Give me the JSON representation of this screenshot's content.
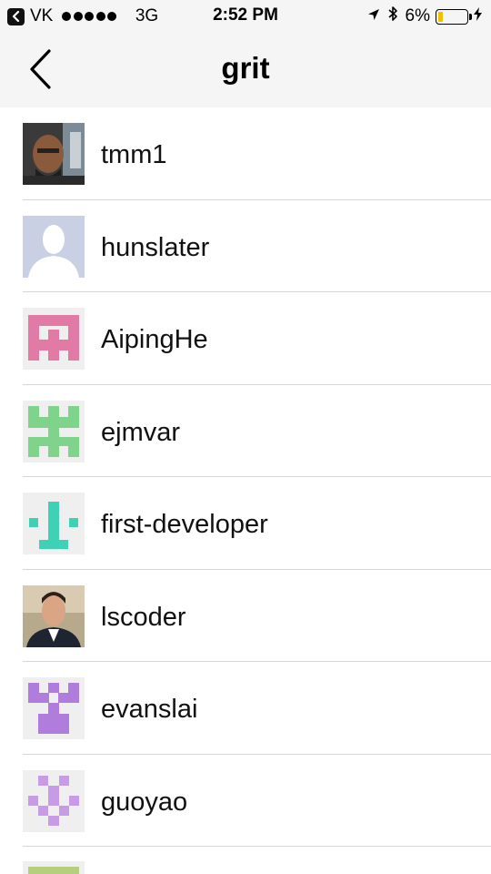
{
  "status_bar": {
    "back_app": "VK",
    "signal_dots": 5,
    "network": "3G",
    "time": "2:52 PM",
    "battery_percent": "6%",
    "battery_level": 0.06,
    "icons": [
      "location-arrow-icon",
      "bluetooth-icon",
      "battery-icon",
      "charging-bolt-icon"
    ]
  },
  "nav": {
    "title": "grit",
    "back_icon": "chevron-left-icon"
  },
  "users": [
    {
      "username": "tmm1",
      "avatar": "photo"
    },
    {
      "username": "hunslater",
      "avatar": "default-silhouette"
    },
    {
      "username": "AipingHe",
      "avatar": "identicon",
      "color": "#e27aa6"
    },
    {
      "username": "ejmvar",
      "avatar": "identicon",
      "color": "#7fd38a"
    },
    {
      "username": "first-developer",
      "avatar": "identicon",
      "color": "#3fd1b6"
    },
    {
      "username": "lscoder",
      "avatar": "photo"
    },
    {
      "username": "evanslai",
      "avatar": "identicon",
      "color": "#b07ddc"
    },
    {
      "username": "guoyao",
      "avatar": "identicon",
      "color": "#c79be6"
    }
  ],
  "partial_avatar_color": "#b6cf7e"
}
